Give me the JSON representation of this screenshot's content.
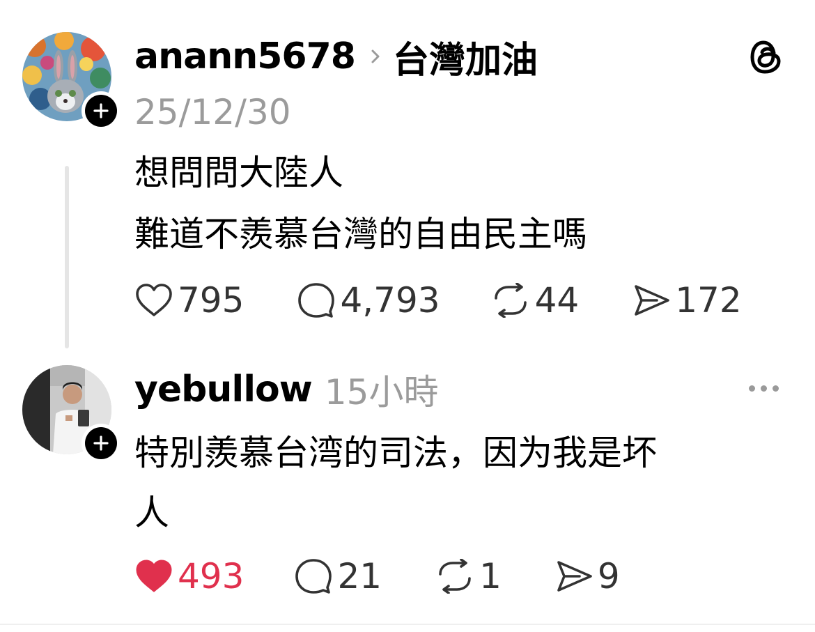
{
  "post": {
    "username": "anann5678",
    "topic": "台灣加油",
    "date": "25/12/30",
    "text_line1": "想問問大陸人",
    "text_line2": "難道不羨慕台灣的自由民主嗎",
    "likes": "795",
    "replies": "4,793",
    "reposts": "44",
    "shares": "172",
    "brand_icon": "threads-logo-icon"
  },
  "reply": {
    "username": "yebullow",
    "time": "15小時",
    "text_line1": "特別羨慕台湾的司法，因为我是坏",
    "text_line2": "人",
    "likes": "493",
    "liked": true,
    "replies": "21",
    "reposts": "1",
    "shares": "9"
  },
  "colors": {
    "liked": "#e0304d",
    "muted": "#9b9b9b",
    "thread_line": "#e5e5e5"
  }
}
